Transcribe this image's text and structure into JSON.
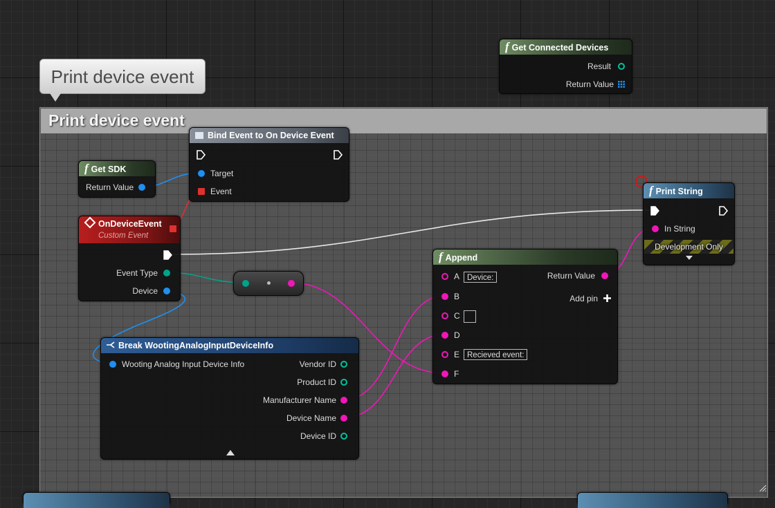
{
  "comment_bubble": "Print device event",
  "comment_title": "Print device event",
  "get_connected_devices": {
    "title": "Get Connected Devices",
    "pins": [
      "Result",
      "Return Value"
    ]
  },
  "bind_event": {
    "title": "Bind Event to On Device Event",
    "pins": [
      "Target",
      "Event"
    ]
  },
  "get_sdk": {
    "title": "Get SDK",
    "pins": [
      "Return Value"
    ]
  },
  "on_device_event": {
    "title": "OnDeviceEvent",
    "subtitle": "Custom Event",
    "pins": [
      "Event Type",
      "Device"
    ]
  },
  "print_string": {
    "title": "Print String",
    "pins": [
      "In String"
    ],
    "dev_only": "Development Only"
  },
  "append": {
    "title": "Append",
    "pin_letters": [
      "A",
      "B",
      "C",
      "D",
      "E",
      "F"
    ],
    "a_value": "Device:",
    "e_value": "Recieved event:",
    "return_value": "Return Value",
    "add_pin": "Add pin"
  },
  "break_struct": {
    "title": "Break WootingAnalogInputDeviceInfo",
    "input": "Wooting Analog Input Device Info",
    "outputs": [
      "Vendor ID",
      "Product ID",
      "Manufacturer Name",
      "Device Name",
      "Device ID"
    ]
  },
  "colors": {
    "exec": "#ffffff",
    "object": "#1f8ff0",
    "string": "#f016b8",
    "byte": "#00a38a",
    "delegate": "#e03030"
  }
}
